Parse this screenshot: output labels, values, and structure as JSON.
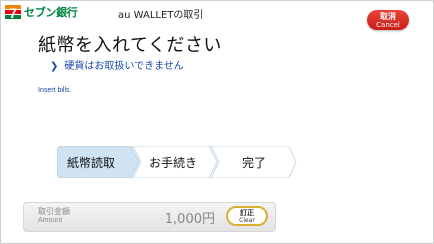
{
  "header": {
    "brand": "セブン銀行",
    "screen_title": "au WALLETの取引",
    "cancel_jp": "取消",
    "cancel_en": "Cancel"
  },
  "main": {
    "instruction": "紙幣を入れてください",
    "coin_note": "硬貨はお取扱いできません",
    "instruction_en": "Insert bills."
  },
  "steps": [
    {
      "label": "紙幣読取",
      "active": true
    },
    {
      "label": "お手続き",
      "active": false
    },
    {
      "label": "完了",
      "active": false
    }
  ],
  "amount": {
    "label_jp": "取引金額",
    "label_en": "Amount",
    "value": "1,000円",
    "clear_jp": "訂正",
    "clear_en": "Clear"
  },
  "colors": {
    "brand_green": "#00843d",
    "brand_orange": "#f08300",
    "brand_red": "#e60012",
    "cancel_red": "#d7281e",
    "link_blue": "#1a4aa8",
    "step_active": "#cfe3f2"
  }
}
